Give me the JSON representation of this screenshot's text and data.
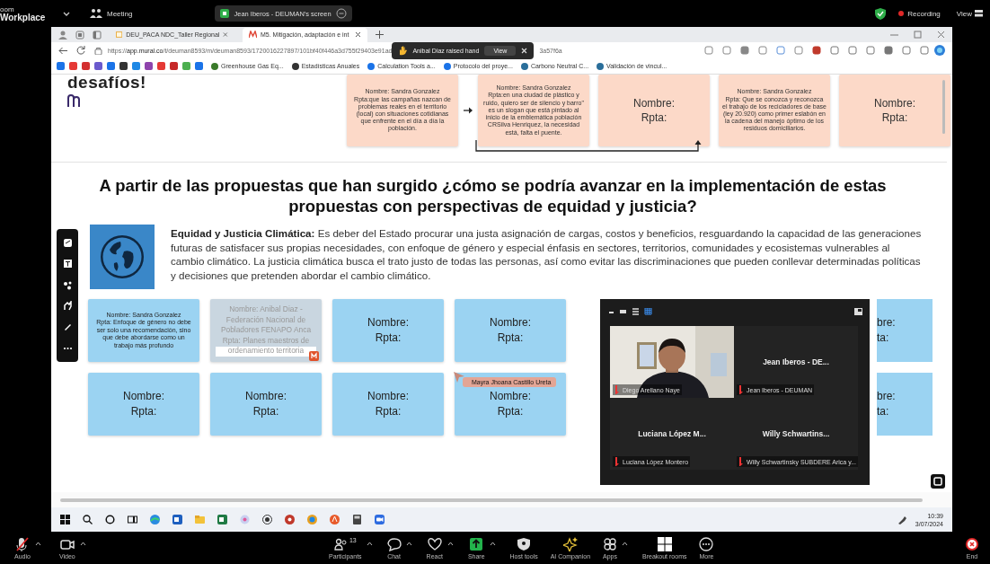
{
  "zoom_top_bar": {
    "app_name": [
      "oom",
      "Workplace"
    ],
    "meeting_menu": "Meeting",
    "shared_screen": "Jean Iberos - DEUMAN's screen",
    "recording": "Recording",
    "view": "View"
  },
  "browser": {
    "tabs": [
      {
        "label": "DEU_PACA NDC_Taller Regional",
        "selected": false
      },
      {
        "label": "M5. Mitigación, adaptación e int",
        "selected": true
      }
    ],
    "url": "https://**app.mural.co**/t/deuman8593/m/deuman8593/1720016227897/101bf40f446a3d755f29403e91ad",
    "url_tail": "3a57f6a",
    "bookmarks": [
      "Greenhouse Gas Eq...",
      "Estadísticas Anuales",
      "Calculation Tools a...",
      "Protocolo del proye...",
      "Carbono Neutral C...",
      "Validación de vincul..."
    ]
  },
  "notification": {
    "text": "Anibal Diaz raised hand",
    "action": "View"
  },
  "mural": {
    "partial_title": "desafíos!",
    "top_notes": [
      {
        "kind": "answer",
        "name": "Nombre: Sandra Gonzalez",
        "answer": "Rpta:que las campañas nazcan de problemas reales en el territorio (local) con situaciones cotidianas que enfrente en el día a día la población."
      },
      {
        "kind": "answer",
        "name": "Nombre: Sandra Gonzalez",
        "answer": "Rpta:en una ciudad de plástico y ruido, quiero ser de silencio y barro\" es un slogan que está pintado al  inicio de la emblemática población CRSilva Henriquez, la necesidad está, falta el puente."
      },
      {
        "kind": "blank",
        "name": "Nombre:",
        "answer": "Rpta:"
      },
      {
        "kind": "answer",
        "name": "Nombre: Sandra Gonzalez",
        "answer": "Rpta: Que se conozca y reconozca el trabajo de los recicladores de base (ley  20.920) como primer eslabón en la cadena del manejo óptimo de los residuos domiciliarios."
      },
      {
        "kind": "blank",
        "name": "Nombre:",
        "answer": "Rpta:"
      }
    ],
    "question": "A partir de las propuestas que han surgido ¿cómo se podría avanzar en la implementación de estas propuestas con perspectivas de equidad y justicia?",
    "info": "**Equidad y Justicia Climática:** Es deber del Estado procurar una justa asignación de cargas, costos y beneficios, resguardando la capacidad de las generaciones futuras de satisfacer sus propias necesidades, con enfoque de género y especial énfasis en sectores, territorios, comunidades y ecosistemas vulnerables al cambio climático.  La justicia climática busca el trato justo de todas las personas, así como evitar las discriminaciones que pueden conllevar determinadas políticas y decisiones que pretenden abordar el cambio climático.",
    "note_rows": [
      [
        {
          "kind": "answer",
          "editing": false,
          "name": "Nombre: Sandra Gonzalez",
          "answer": "Rpta: Enfoque de género no debe ser solo una recomendación, sino que debe abordarse como un trabajo más profundo"
        },
        {
          "kind": "answer",
          "editing": true,
          "name": "Nombre: Anibal Diaz - Federación Nacional de Pobladores FENAPO Anca",
          "answer": "Rpta: Planes maestros de ordenamiento territoria"
        },
        {
          "kind": "blank",
          "editing": false,
          "name": "Nombre:",
          "answer": "Rpta:"
        },
        {
          "kind": "blank",
          "editing": false,
          "name": "Nombre:",
          "answer": "Rpta:"
        },
        {
          "kind": "partial",
          "editing": false,
          "name": "bre:",
          "answer": "ta:"
        }
      ],
      [
        {
          "kind": "blank",
          "editing": false,
          "name": "Nombre:",
          "answer": "Rpta:"
        },
        {
          "kind": "blank",
          "editing": false,
          "name": "Nombre:",
          "answer": "Rpta:"
        },
        {
          "kind": "blank",
          "editing": false,
          "name": "Nombre:",
          "answer": "Rpta:"
        },
        {
          "kind": "blank",
          "editing": false,
          "name": "Nombre:",
          "answer": "Rpta:"
        },
        {
          "kind": "partial",
          "editing": false,
          "name": "bre:",
          "answer": "ta:"
        }
      ]
    ],
    "cursor_label": "Mayra Jhoana Castillo Ureta"
  },
  "video_panel": {
    "tile_rows": [
      [
        {
          "kind": "video",
          "caption": "Diego Arellano Naye"
        },
        {
          "kind": "name",
          "name": "Jean Iberos - DE...",
          "caption": "Jean Iberos - DEUMAN"
        }
      ],
      [
        {
          "kind": "name",
          "name": "Luciana López M...",
          "caption": "Luciana López Montero"
        },
        {
          "kind": "name",
          "name": "Willy Schwartins...",
          "caption": "Willy Schwartinsky SUBDERE Arica y..."
        }
      ]
    ]
  },
  "taskbar": {
    "time": "10:39",
    "date": "3/07/2024"
  },
  "meeting_toolbar": [
    {
      "kind": "audio",
      "label": "Audio",
      "has_menu": true,
      "muted": true
    },
    {
      "kind": "video",
      "label": "Video",
      "has_menu": true,
      "muted": false
    },
    {
      "kind": "participants",
      "label": "Participants",
      "count": "13",
      "has_menu": true
    },
    {
      "kind": "chat",
      "label": "Chat",
      "has_menu": true
    },
    {
      "kind": "react",
      "label": "React",
      "has_menu": true
    },
    {
      "kind": "share",
      "label": "Share",
      "has_menu": true
    },
    {
      "kind": "host",
      "label": "Host tools",
      "has_menu": false
    },
    {
      "kind": "ai",
      "label": "AI Companion",
      "has_menu": false
    },
    {
      "kind": "apps",
      "label": "Apps",
      "has_menu": true
    },
    {
      "kind": "breakout",
      "label": "Breakout rooms",
      "has_menu": false
    },
    {
      "kind": "more",
      "label": "More",
      "has_menu": false
    },
    {
      "kind": "end",
      "label": "End",
      "has_menu": false
    }
  ]
}
